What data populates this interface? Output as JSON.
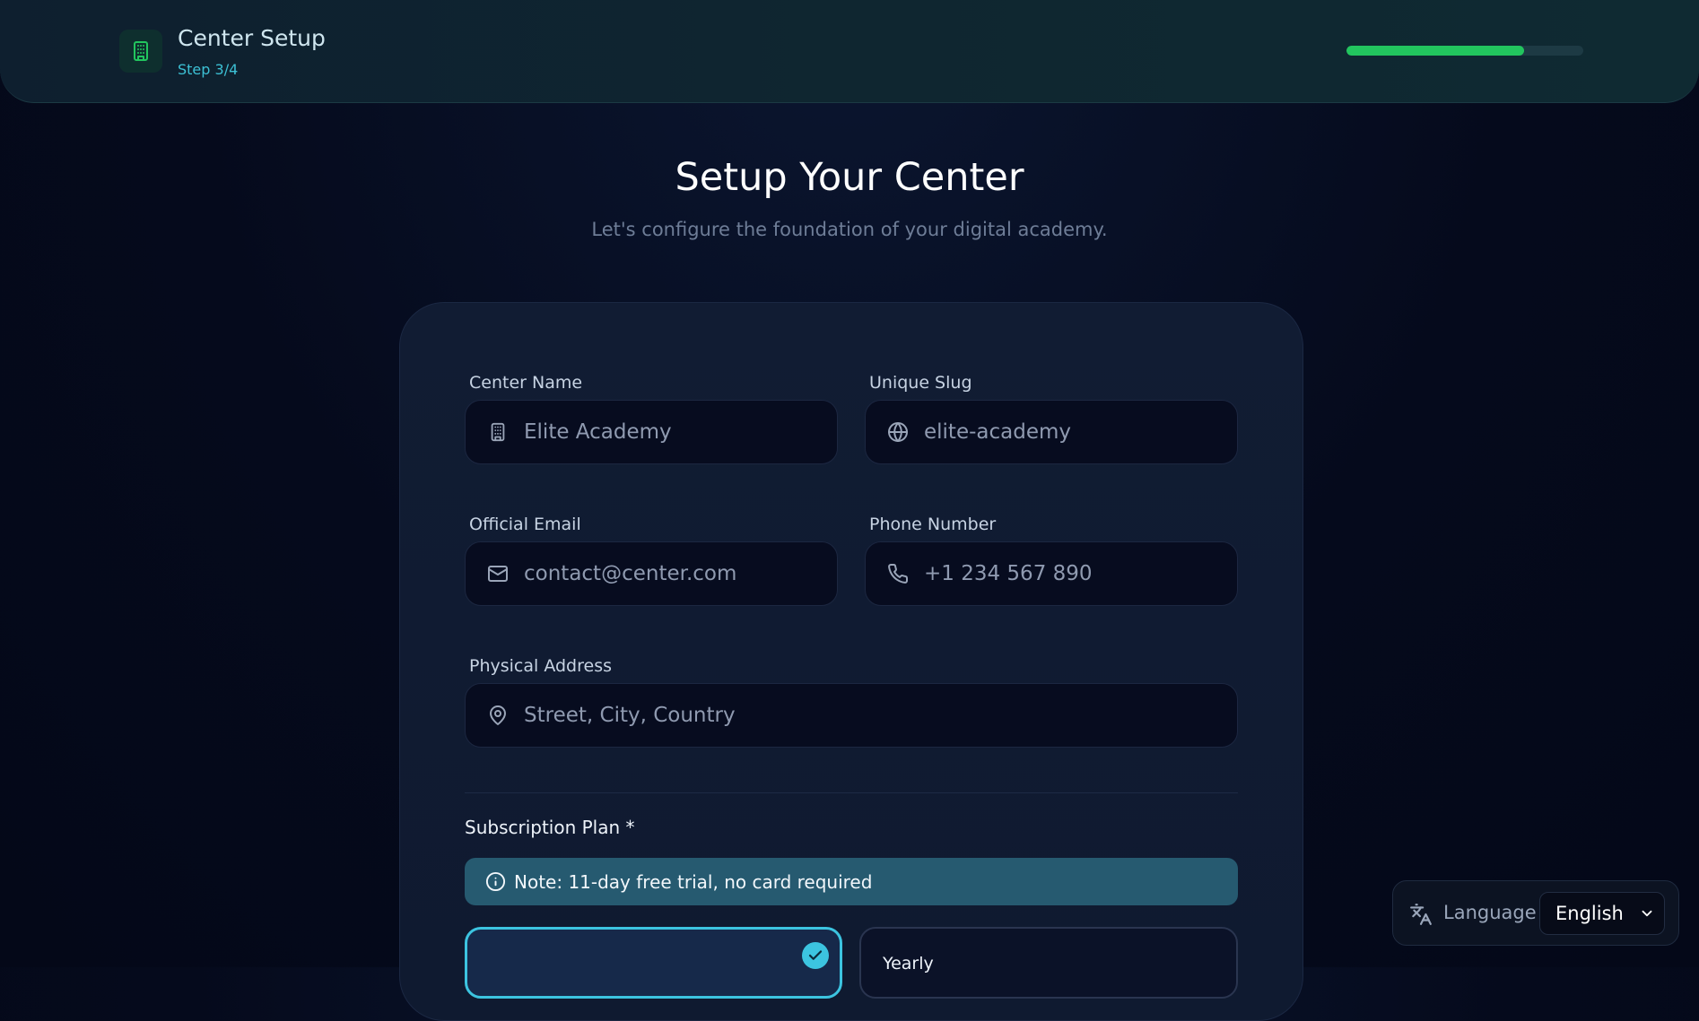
{
  "header": {
    "title": "Center Setup",
    "step": "Step 3/4",
    "progress": 0.75,
    "accent_color": "#22c55e"
  },
  "page": {
    "title": "Setup Your Center",
    "subtitle": "Let's configure the foundation of your digital academy."
  },
  "form": {
    "center_name": {
      "label": "Center Name",
      "placeholder": "Elite Academy",
      "icon": "building-icon"
    },
    "slug": {
      "label": "Unique Slug",
      "placeholder": "elite-academy",
      "icon": "globe-icon"
    },
    "email": {
      "label": "Official Email",
      "placeholder": "contact@center.com",
      "icon": "mail-icon"
    },
    "phone": {
      "label": "Phone Number",
      "placeholder": "+1 234 567 890",
      "icon": "phone-icon"
    },
    "address": {
      "label": "Physical Address",
      "placeholder": "Street, City, Country",
      "icon": "map-pin-icon"
    }
  },
  "subscription": {
    "label": "Subscription Plan *",
    "note": "Note: 11-day free trial, no card required",
    "plans": [
      {
        "name": "",
        "selected": true
      },
      {
        "name": "Yearly",
        "selected": false
      }
    ]
  },
  "language": {
    "label": "Language",
    "selected": "English",
    "icon": "translate-icon"
  }
}
